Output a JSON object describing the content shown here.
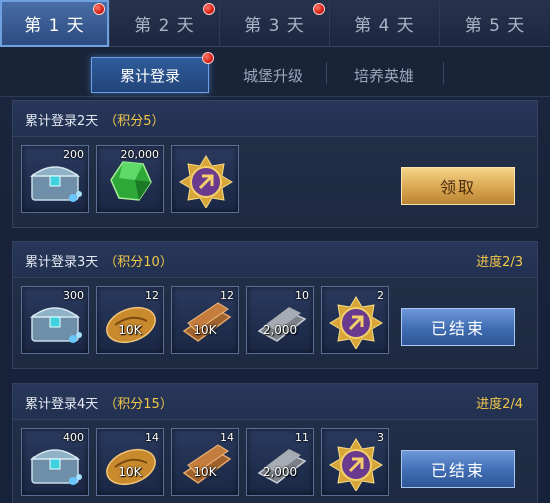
{
  "day_tabs": [
    {
      "label": "第 1 天",
      "active": true,
      "has_badge": true
    },
    {
      "label": "第 2 天",
      "active": false,
      "has_badge": true
    },
    {
      "label": "第 3 天",
      "active": false,
      "has_badge": true
    },
    {
      "label": "第 4 天",
      "active": false,
      "has_badge": false
    },
    {
      "label": "第 5 天",
      "active": false,
      "has_badge": false
    }
  ],
  "sub_tabs": [
    {
      "label": "累计登录",
      "active": true,
      "has_badge": true
    },
    {
      "label": "城堡升级",
      "active": false,
      "has_badge": false
    },
    {
      "label": "培养英雄",
      "active": false,
      "has_badge": false
    }
  ],
  "rewards": [
    {
      "title": "累计登录2天",
      "points": "（积分5）",
      "progress": "",
      "button": "领取",
      "button_state": "claimable",
      "items": [
        {
          "icon": "treasure-chest-icon",
          "count": "200",
          "label": ""
        },
        {
          "icon": "green-gem-icon",
          "count": "20,000",
          "label": ""
        },
        {
          "icon": "medal-emblem-icon",
          "count": "",
          "label": ""
        }
      ]
    },
    {
      "title": "累计登录3天",
      "points": "（积分10）",
      "progress": "进度2/3",
      "button": "已结束",
      "button_state": "ended",
      "items": [
        {
          "icon": "treasure-chest-icon",
          "count": "300",
          "label": ""
        },
        {
          "icon": "bread-icon",
          "count": "12",
          "label": "10K"
        },
        {
          "icon": "wood-planks-icon",
          "count": "12",
          "label": "10K"
        },
        {
          "icon": "iron-ingot-icon",
          "count": "10",
          "label": "2,000"
        },
        {
          "icon": "medal-emblem-icon",
          "count": "2",
          "label": ""
        }
      ]
    },
    {
      "title": "累计登录4天",
      "points": "（积分15）",
      "progress": "进度2/4",
      "button": "已结束",
      "button_state": "ended",
      "items": [
        {
          "icon": "treasure-chest-icon",
          "count": "400",
          "label": ""
        },
        {
          "icon": "bread-icon",
          "count": "14",
          "label": "10K"
        },
        {
          "icon": "wood-planks-icon",
          "count": "14",
          "label": "10K"
        },
        {
          "icon": "iron-ingot-icon",
          "count": "11",
          "label": "2,000"
        },
        {
          "icon": "medal-emblem-icon",
          "count": "3",
          "label": ""
        }
      ]
    }
  ],
  "colors": {
    "accent_gold": "#f3c84a",
    "claim_button": "#d9a650",
    "ended_button": "#3f6cb3",
    "badge_red": "#d31f15"
  }
}
